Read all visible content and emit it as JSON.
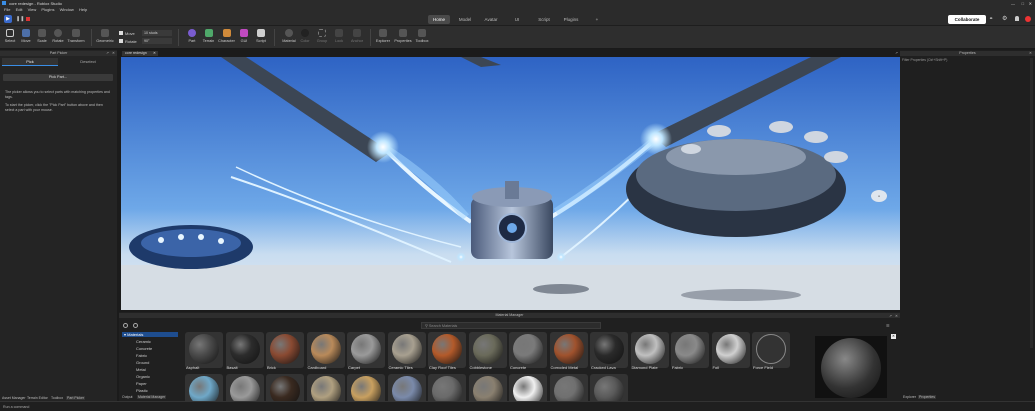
{
  "window": {
    "title": "core redesign - Roblox Studio"
  },
  "menu": [
    "File",
    "Edit",
    "View",
    "Plugins",
    "Window",
    "Help"
  ],
  "top_tabs": [
    {
      "label": "Home",
      "active": true
    },
    {
      "label": "Model",
      "active": false
    },
    {
      "label": "Avatar",
      "active": false
    },
    {
      "label": "UI",
      "active": false
    },
    {
      "label": "Script",
      "active": false
    },
    {
      "label": "Plugins",
      "active": false
    },
    {
      "label": "+",
      "active": false
    }
  ],
  "collaborate_label": "Collaborate",
  "toolbar": {
    "tools": [
      "Select",
      "Move",
      "Scale",
      "Rotate",
      "Transform"
    ],
    "geometric_label": "Geometric",
    "move_check": "Move",
    "rotate_check": "Rotate",
    "move_value": "10 studs",
    "rotate_value": "90°",
    "insert": [
      "Part",
      "Terrain",
      "Character",
      "GUI",
      "Script"
    ],
    "edit": [
      "Material",
      "Color",
      "Group",
      "Lock",
      "Anchor"
    ],
    "view": [
      "Explorer",
      "Properties",
      "Toolbox"
    ]
  },
  "part_picker": {
    "header": "Part Picker",
    "tab_pick": "Pick",
    "tab_deselect": "Deselect",
    "pick_button": "Pick Part...",
    "description": "The picker allows you to select parts with matching properties and tags.",
    "instructions": "To start the picker, click the \"Pick Part\" button above and then select a part with your mouse."
  },
  "viewport_tab": "core redesign",
  "material_manager": {
    "header": "Material Manager",
    "search_placeholder": "Search Materials",
    "categories_root": "Materials",
    "categories": [
      "Ceramic",
      "Concrete",
      "Fabric",
      "Ground",
      "Metal",
      "Organic",
      "Paper",
      "Plastic"
    ],
    "materials": [
      {
        "name": "Asphalt",
        "color": "#4a4a4a"
      },
      {
        "name": "Basalt",
        "color": "#2c2c2c"
      },
      {
        "name": "Brick",
        "color": "#8a4a32"
      },
      {
        "name": "Cardboard",
        "color": "#b98a5a"
      },
      {
        "name": "Carpet",
        "color": "#9a9a9a"
      },
      {
        "name": "Ceramic Tiles",
        "color": "#a8a090"
      },
      {
        "name": "Clay Roof Tiles",
        "color": "#b35a2a"
      },
      {
        "name": "Cobblestone",
        "color": "#6a6a5a"
      },
      {
        "name": "Concrete",
        "color": "#7a7a7a"
      },
      {
        "name": "Corroded Metal",
        "color": "#a0522d"
      },
      {
        "name": "Cracked Lava",
        "color": "#2a2a2a"
      },
      {
        "name": "Diamond Plate",
        "color": "#c0c0c0"
      },
      {
        "name": "Fabric",
        "color": "#8a8a8a"
      },
      {
        "name": "Foil",
        "color": "#d0d0d0"
      },
      {
        "name": "Force Field",
        "color": "#1e1e1e"
      }
    ],
    "row2_colors": [
      "#6fa8c8",
      "#9a9a9a",
      "#3a2a20",
      "#b0a080",
      "#c8a060",
      "#7a8aaa",
      "#6a6a6a",
      "#8a8070",
      "#f0f0f0",
      "#707070",
      "#5a5a5a"
    ]
  },
  "properties": {
    "header": "Properties",
    "filter_placeholder": "Filter Properties (Ctrl+Shift+P)",
    "tabs": [
      "Explorer",
      "Properties"
    ]
  },
  "bottom_tabs": [
    "Asset Manager",
    "Terrain Editor",
    "Toolbox",
    "Part Picker"
  ],
  "bottom_tabs_mm": [
    "Output",
    "Material Manager"
  ],
  "command_placeholder": "Run a command",
  "colors": {
    "accent": "#3a8ee6",
    "active_tab": "#4a4a4a"
  }
}
